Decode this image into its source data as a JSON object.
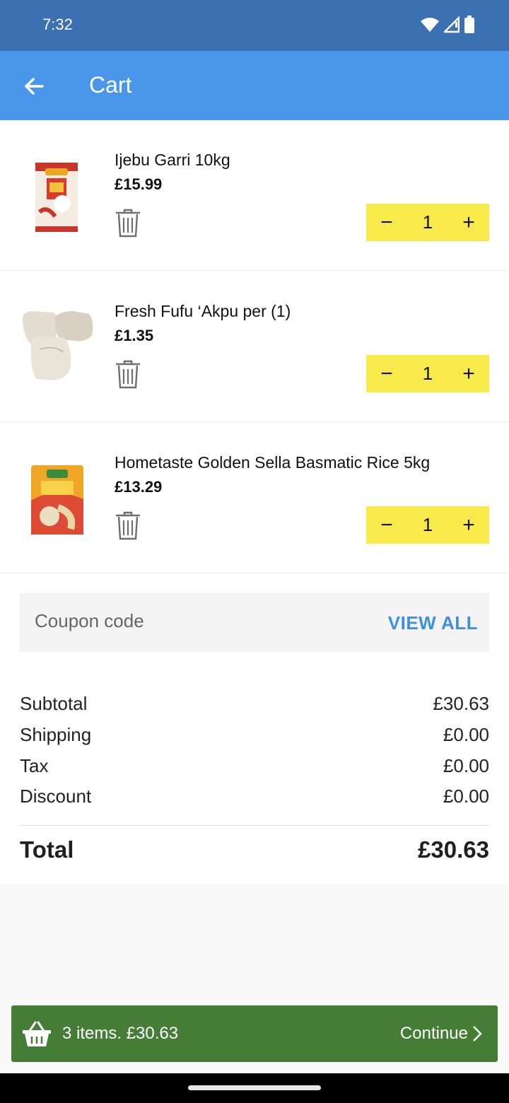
{
  "status_bar": {
    "time": "7:32"
  },
  "app_bar": {
    "title": "Cart",
    "back_icon": "arrow-left-icon"
  },
  "cart": {
    "items": [
      {
        "name": "Ijebu Garri 10kg",
        "price": "£15.99",
        "quantity": "1"
      },
      {
        "name": "Fresh Fufu ‘Akpu per (1)",
        "price": "£1.35",
        "quantity": "1"
      },
      {
        "name": "Hometaste Golden Sella Basmatic Rice 5kg",
        "price": "£13.29",
        "quantity": "1"
      }
    ],
    "decrement_symbol": "−",
    "increment_symbol": "+"
  },
  "coupon": {
    "placeholder": "Coupon code",
    "view_all": "VIEW ALL"
  },
  "summary": {
    "subtotal_label": "Subtotal",
    "subtotal_value": "£30.63",
    "shipping_label": "Shipping",
    "shipping_value": "£0.00",
    "tax_label": "Tax",
    "tax_value": "£0.00",
    "discount_label": "Discount",
    "discount_value": "£0.00",
    "total_label": "Total",
    "total_value": "£30.63"
  },
  "checkout": {
    "summary_text": "3 items. £30.63",
    "continue_label": "Continue"
  },
  "colors": {
    "status_bar": "#3b70b3",
    "app_bar": "#4a96ea",
    "stepper": "#f9ea4c",
    "link": "#3f8fdf",
    "checkout_bar": "#457d36"
  }
}
